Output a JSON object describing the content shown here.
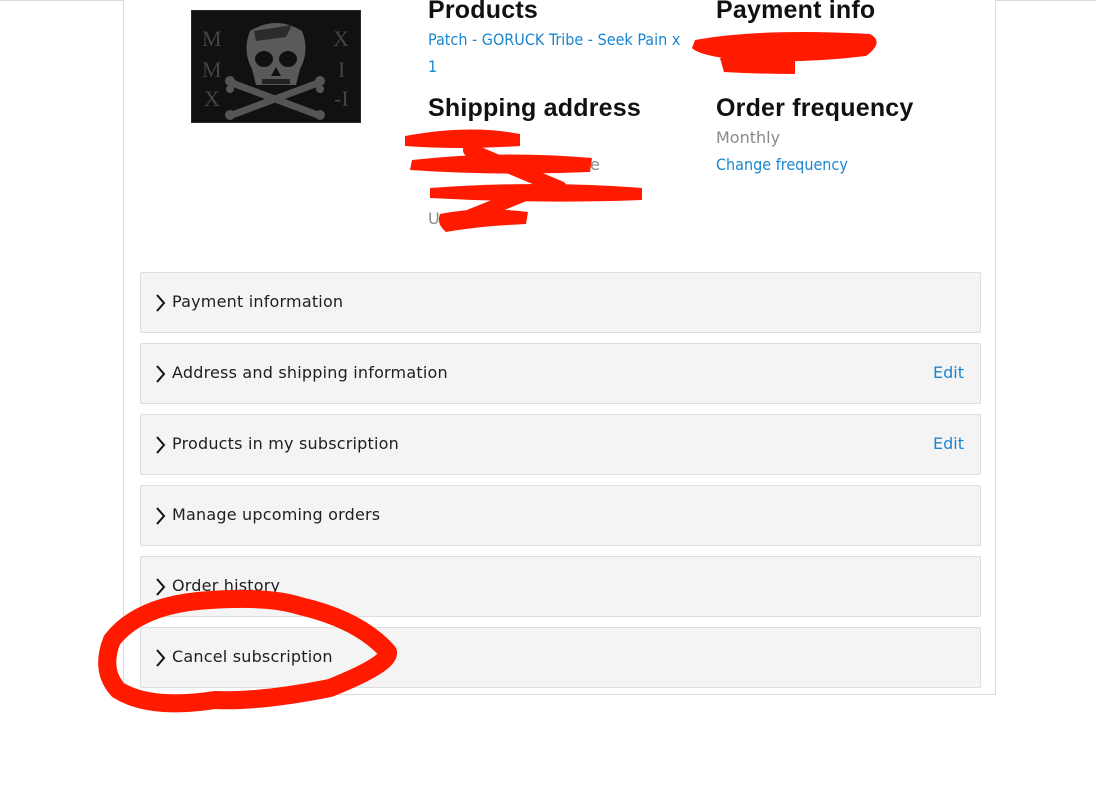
{
  "summary": {
    "products_heading": "Products",
    "products_line": "Patch - GORUCK Tribe - Seek Pain x",
    "products_qty": "1",
    "payment_heading": "Payment info",
    "shipping_heading": "Shipping address",
    "shipping_fragment_1": "e",
    "shipping_fragment_2": "U",
    "frequency_heading": "Order frequency",
    "frequency_value": "Monthly",
    "change_frequency_link": "Change frequency"
  },
  "product_image": {
    "icon": "skull-crossbones-logo-icon",
    "left_letters": "MMX",
    "right_letters": "XII"
  },
  "sections": [
    {
      "label": "Payment information",
      "edit": ""
    },
    {
      "label": "Address and shipping information",
      "edit": "Edit"
    },
    {
      "label": "Products in my subscription",
      "edit": "Edit"
    },
    {
      "label": "Manage upcoming orders",
      "edit": ""
    },
    {
      "label": "Order history",
      "edit": ""
    },
    {
      "label": "Cancel subscription",
      "edit": ""
    }
  ],
  "colors": {
    "link": "#1a86d0",
    "accordion_bg": "#f4f4f4",
    "annotation_red": "#ff1a00"
  }
}
